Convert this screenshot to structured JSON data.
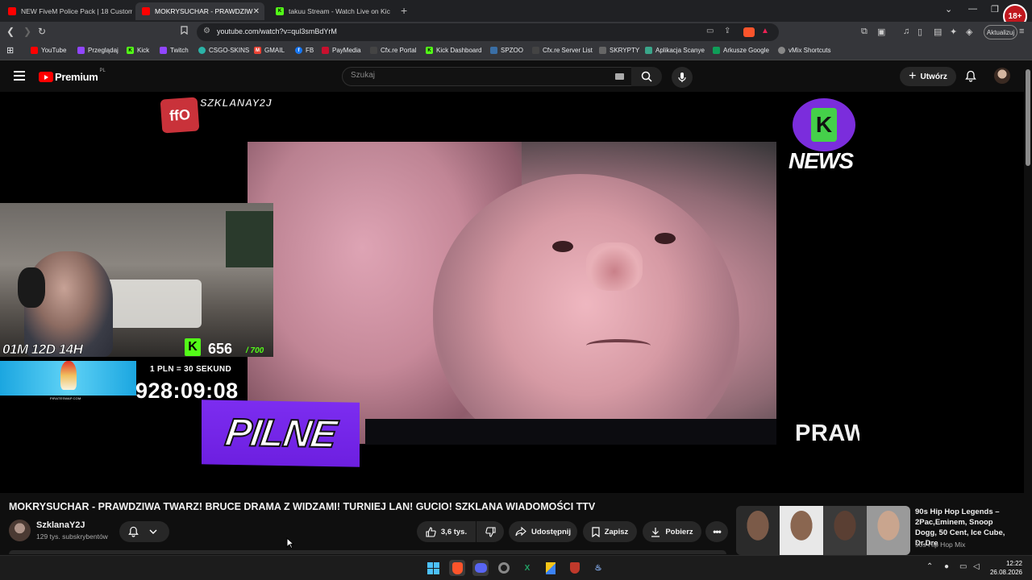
{
  "browser": {
    "tabs": [
      {
        "label": "NEW FiveM Police Pack | 18 Custom",
        "icon": "youtube-icon",
        "active": false
      },
      {
        "label": "MOKRYSUCHAR - PRAWDZIW",
        "icon": "youtube-audio-icon",
        "active": true
      },
      {
        "label": "takuu Stream - Watch Live on Kic",
        "icon": "kick-icon",
        "active": false
      }
    ],
    "url": "youtube.com/watch?v=qul3smBdYrM",
    "update_label": "Aktualizuj",
    "extension_badge": "18+",
    "bookmarks": [
      {
        "label": "YouTube",
        "color": "#ff0000"
      },
      {
        "label": "Przeglądaj",
        "color": "#9146ff"
      },
      {
        "label": "Kick",
        "color": "#53fc18"
      },
      {
        "label": "Twitch",
        "color": "#9146ff"
      },
      {
        "label": "CSGO-SKINS",
        "color": "#2bb3a8"
      },
      {
        "label": "GMAIL",
        "color": "#ea4335"
      },
      {
        "label": "FB",
        "color": "#1877f2"
      },
      {
        "label": "PayMedia",
        "color": "#c8102e"
      },
      {
        "label": "Cfx.re Portal",
        "color": "#444444"
      },
      {
        "label": "Kick Dashboard",
        "color": "#53fc18"
      },
      {
        "label": "SPZOO",
        "color": "#3a6ea5"
      },
      {
        "label": "Cfx.re Server List",
        "color": "#444444"
      },
      {
        "label": "SKRYPTY",
        "color": "#666666"
      },
      {
        "label": "Aplikacja Scanye",
        "color": "#3aa58a"
      },
      {
        "label": "Arkusze Google",
        "color": "#0f9d58"
      },
      {
        "label": "vMix Shortcuts",
        "color": "#888888"
      }
    ]
  },
  "youtube": {
    "logo_text": "Premium",
    "logo_region": "PL",
    "search_placeholder": "Szukaj",
    "create_label": "Utwórz"
  },
  "video_overlay": {
    "channel_tag": "SZKLANAY2J",
    "k_logo": "ffO",
    "news_label": "NEWS",
    "webcam_stamp": "01M 12D 14H",
    "kick_badge": "K",
    "viewer_count": "656",
    "viewer_max": "/ 700",
    "ad_label": "PIRATESWAP.COM",
    "pln_rate": "1 PLN = 30 SEKUND",
    "timer": "928:09:08",
    "pilne": "PILNE",
    "ticker": "PRAW"
  },
  "video": {
    "title": "MOKRYSUCHAR - PRAWDZIWA TWARZ! BRUCE DRAMA Z WIDZAMI! TURNIEJ LAN! GUCIO! SZKLANA WIADOMOŚCI TTV",
    "channel_name": "SzklanaY2J",
    "subscribers": "129 tys. subskrybentów",
    "likes": "3,6 tys.",
    "share_label": "Udostępnij",
    "save_label": "Zapisz",
    "download_label": "Pobierz"
  },
  "recommendation": {
    "title": "90s Hip Hop Legends – 2Pac,Eminem, Snoop Dogg, 50 Cent, Ice Cube, Dr.Dre",
    "channel": "90s Hip Hop Mix"
  },
  "taskbar": {
    "time": "12:22",
    "date": "26.08.2026"
  }
}
